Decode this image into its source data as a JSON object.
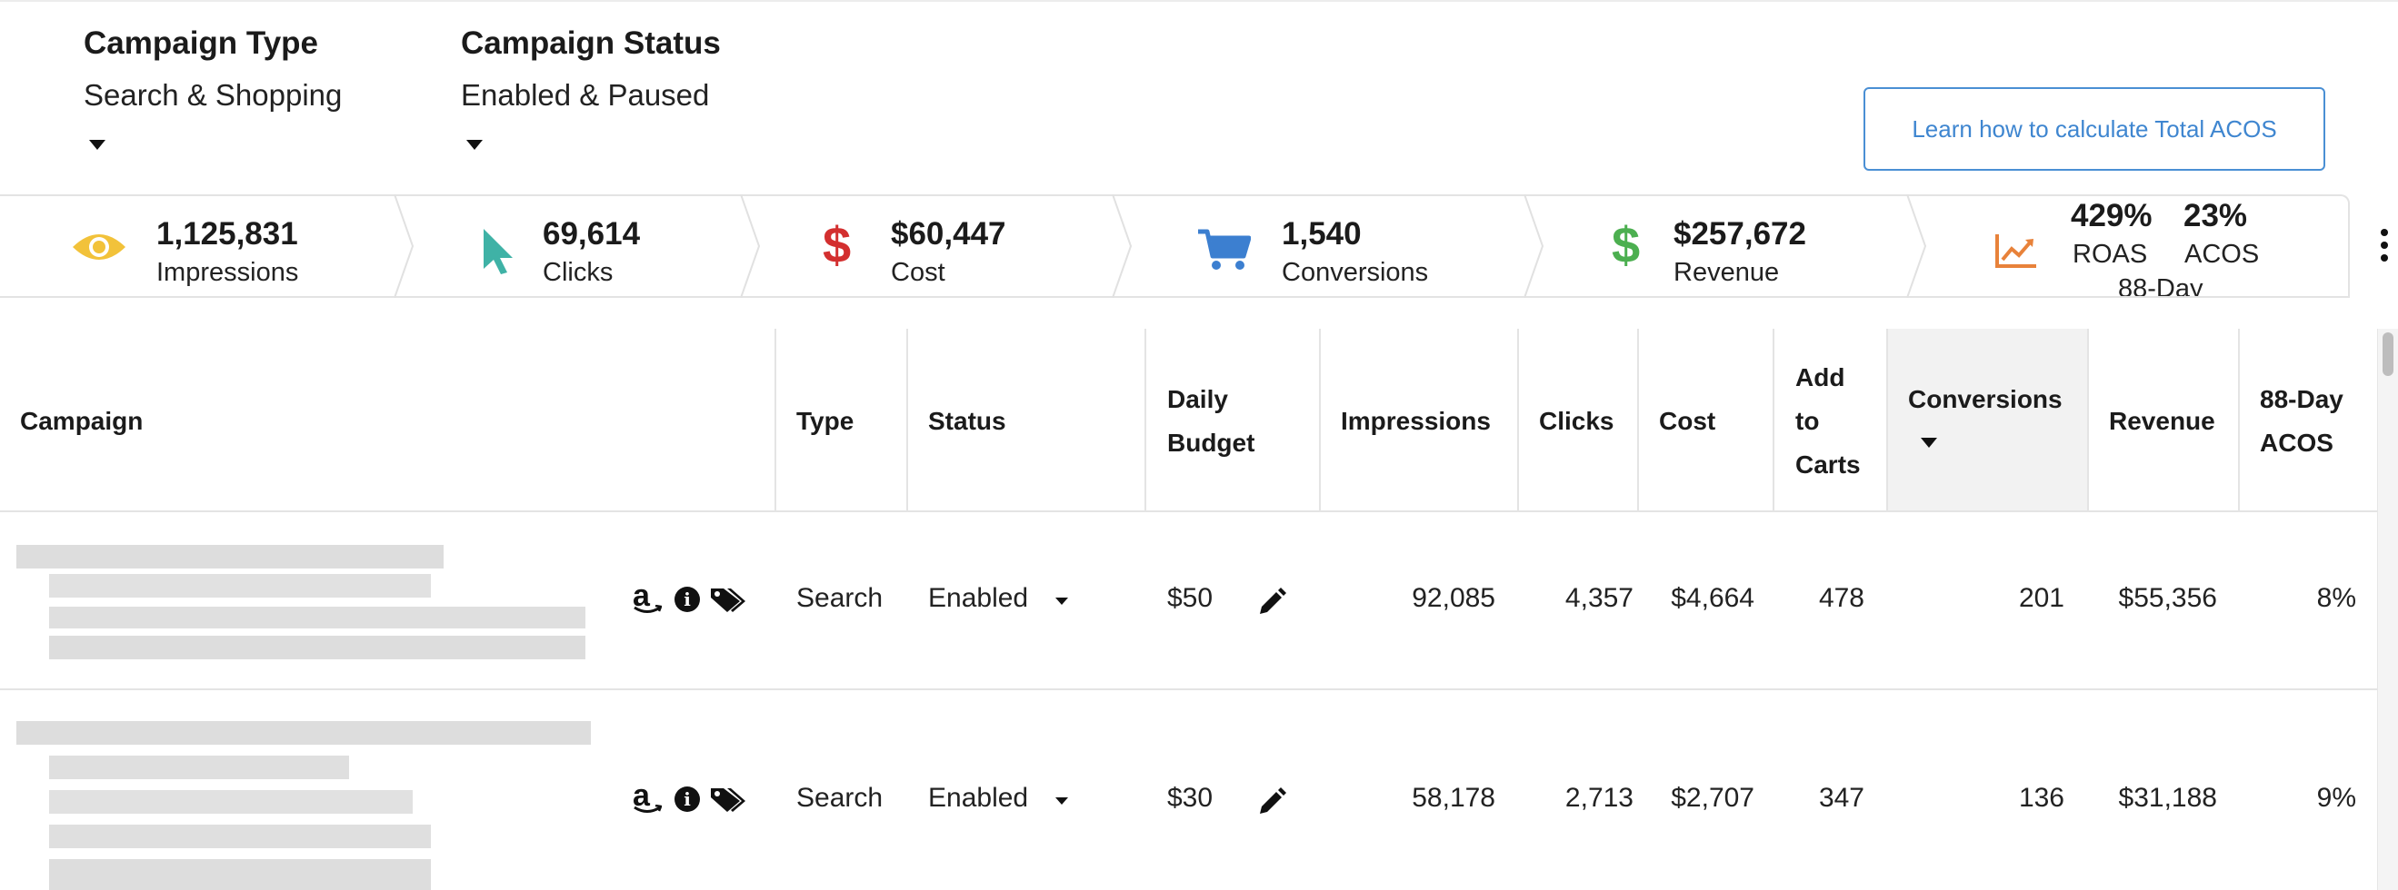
{
  "filters": {
    "campaign_type": {
      "label": "Campaign Type",
      "value": "Search & Shopping"
    },
    "campaign_status": {
      "label": "Campaign Status",
      "value": "Enabled & Paused"
    }
  },
  "learn_button": {
    "label": "Learn how to calculate Total ACOS",
    "color": "#3f86d0"
  },
  "metrics": {
    "impressions": {
      "value": "1,125,831",
      "label": "Impressions",
      "icon": "eye-icon",
      "color": "#f2c23a"
    },
    "clicks": {
      "value": "69,614",
      "label": "Clicks",
      "icon": "cursor-icon",
      "color": "#3fb2a6"
    },
    "cost": {
      "value": "$60,447",
      "label": "Cost",
      "icon": "dollar-icon",
      "color": "#d32f2f"
    },
    "conversions": {
      "value": "1,540",
      "label": "Conversions",
      "icon": "cart-icon",
      "color": "#3c7fd0"
    },
    "revenue": {
      "value": "$257,672",
      "label": "Revenue",
      "icon": "dollar-icon",
      "color": "#4caf50"
    },
    "roas_acos": {
      "roas_value": "429%",
      "roas_label": "ROAS",
      "acos_value": "23%",
      "acos_label": "ACOS",
      "sub_label": "88-Day",
      "icon": "trend-chart-icon",
      "color": "#e8823a"
    }
  },
  "table": {
    "headers": {
      "campaign": "Campaign",
      "type": "Type",
      "status": "Status",
      "daily_budget": [
        "Daily",
        "Budget"
      ],
      "impressions": "Impressions",
      "clicks": "Clicks",
      "cost": "Cost",
      "add_to_carts": [
        "Add",
        "to",
        "Carts"
      ],
      "conversions": "Conversions",
      "revenue": "Revenue",
      "acos": [
        "88-Day",
        "ACOS"
      ]
    },
    "rows": [
      {
        "type": "Search",
        "status": "Enabled",
        "budget": "$50",
        "impressions": "92,085",
        "clicks": "4,357",
        "cost": "$4,664",
        "add_to_carts": "478",
        "conversions": "201",
        "revenue": "$55,356",
        "acos": "8%"
      },
      {
        "type": "Search",
        "status": "Enabled",
        "budget": "$30",
        "impressions": "58,178",
        "clicks": "2,713",
        "cost": "$2,707",
        "add_to_carts": "347",
        "conversions": "136",
        "revenue": "$31,188",
        "acos": "9%"
      }
    ],
    "row_icons": [
      "amazon-icon",
      "info-icon",
      "tags-icon"
    ]
  }
}
